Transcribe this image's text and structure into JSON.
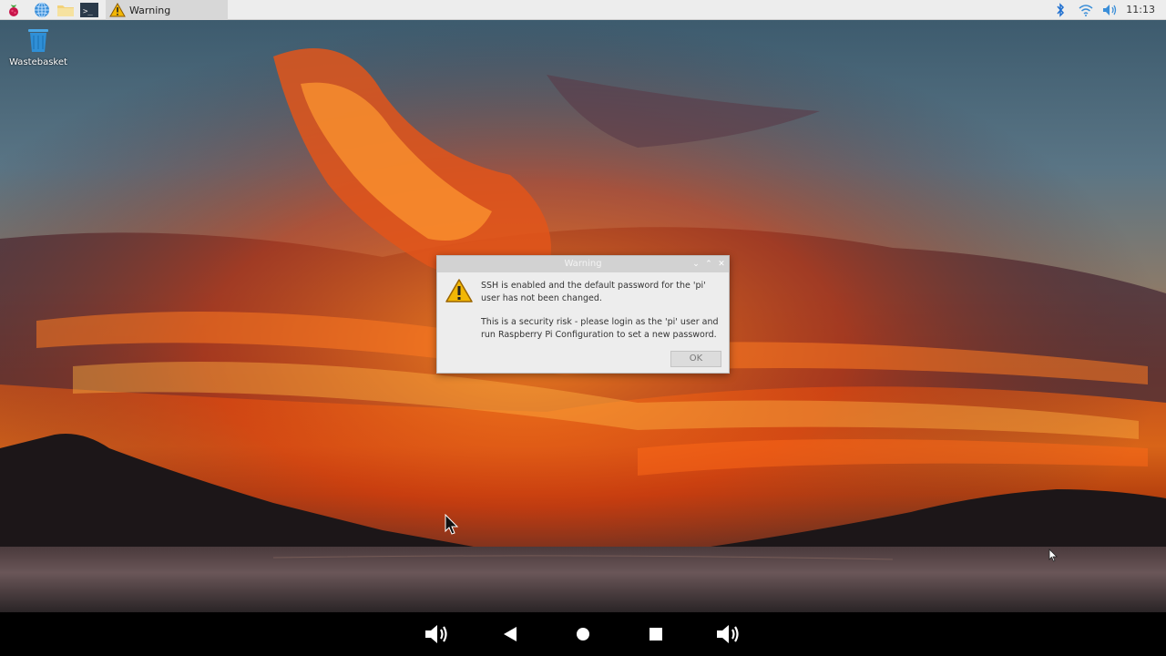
{
  "taskbar": {
    "active_window_label": "Warning",
    "clock": "11:13"
  },
  "desktop": {
    "wastebasket_label": "Wastebasket"
  },
  "dialog": {
    "title": "Warning",
    "line1": "SSH is enabled and the default password for the 'pi' user has not been changed.",
    "line2": "This is a security risk - please login as the 'pi' user and run Raspberry Pi Configuration to set a new password.",
    "ok_label": "OK"
  },
  "colors": {
    "panel": "#ededed",
    "dialog_bg": "#ededed",
    "warning_yellow": "#f2b705"
  }
}
